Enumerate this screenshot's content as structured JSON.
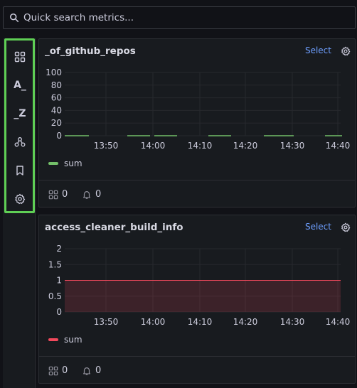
{
  "search": {
    "placeholder": "Quick search metrics..."
  },
  "sidebar": {
    "items": [
      {
        "name": "grid-view",
        "glyph": ""
      },
      {
        "name": "sort-a-z",
        "glyph": "A_"
      },
      {
        "name": "sort-z-a",
        "glyph": "_Z"
      },
      {
        "name": "group-by",
        "glyph": ""
      },
      {
        "name": "bookmarks",
        "glyph": ""
      },
      {
        "name": "settings",
        "glyph": ""
      }
    ]
  },
  "panels": [
    {
      "title": "_of_github_repos",
      "select_label": "Select",
      "legend_label": "sum",
      "color": "#73bf69",
      "footer": {
        "panels_count": "0",
        "alerts_count": "0"
      },
      "chart_data": {
        "type": "line",
        "x_ticks": [
          "13:50",
          "14:00",
          "14:10",
          "14:20",
          "14:30",
          "14:40"
        ],
        "y_ticks": [
          "0",
          "20",
          "40",
          "60",
          "80",
          "100"
        ],
        "ylim": [
          0,
          100
        ],
        "series": [
          {
            "name": "sum",
            "value": 0,
            "gaps": true
          }
        ]
      }
    },
    {
      "title": "access_cleaner_build_info",
      "select_label": "Select",
      "legend_label": "sum",
      "color": "#f2495c",
      "footer": {
        "panels_count": "0",
        "alerts_count": "0"
      },
      "chart_data": {
        "type": "area",
        "x_ticks": [
          "13:50",
          "14:00",
          "14:10",
          "14:20",
          "14:30",
          "14:40"
        ],
        "y_ticks": [
          "0",
          "0.5",
          "1",
          "1.5",
          "2"
        ],
        "ylim": [
          0,
          2
        ],
        "series": [
          {
            "name": "sum",
            "value": 1
          }
        ]
      }
    }
  ]
}
